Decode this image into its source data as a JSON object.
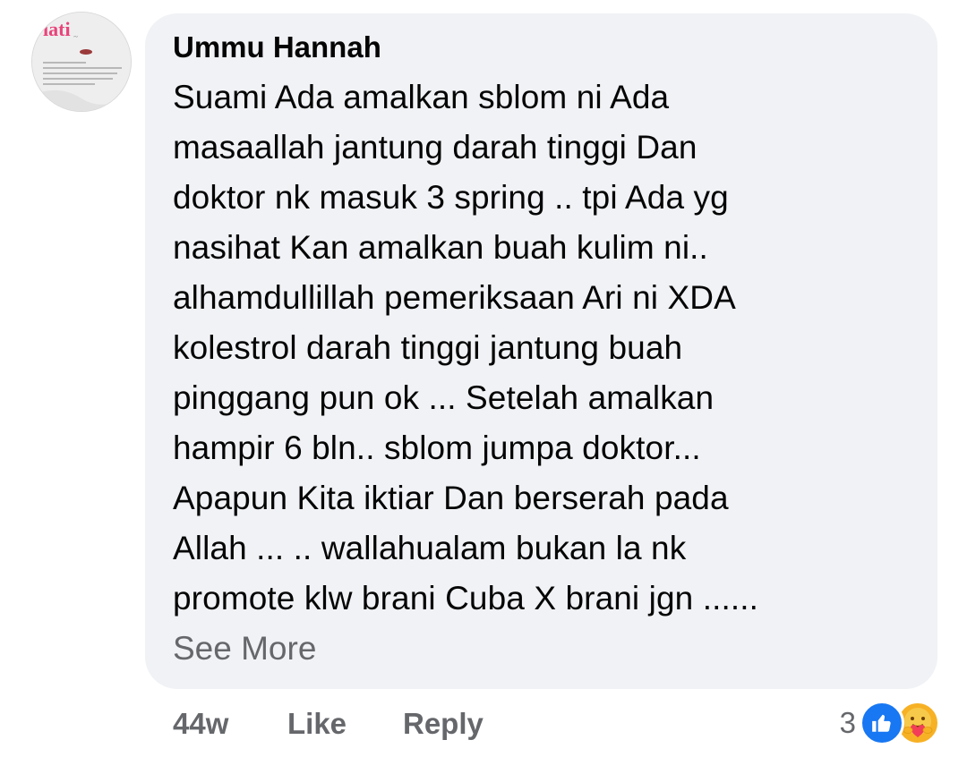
{
  "comment": {
    "author": "Ummu Hannah",
    "lines": [
      "Suami Ada amalkan sblom ni Ada",
      "masaallah jantung darah tinggi Dan",
      "doktor nk masuk 3 spring .. tpi Ada yg",
      "nasihat Kan amalkan buah kulim ni..",
      "alhamdullillah pemeriksaan Ari ni XDA",
      "kolestrol darah tinggi jantung buah",
      "pinggang pun ok ... Setelah amalkan",
      "hampir 6 bln.. sblom jumpa doktor...",
      "Apapun Kita iktiar Dan berserah pada",
      "Allah ... .. wallahualam bukan la nk",
      "promote klw brani Cuba X brani jgn ......"
    ],
    "see_more": "See More"
  },
  "avatar": {
    "brand_text": "iati"
  },
  "actions": {
    "time": "44w",
    "like": "Like",
    "reply": "Reply"
  },
  "reactions": {
    "count": "3",
    "icons": [
      "like-icon",
      "care-icon"
    ]
  },
  "colors": {
    "bubble": "#f0f2f5",
    "text": "#050505",
    "secondary": "#65676b",
    "like_blue": "#1877f2",
    "care_yellow": "#f7b125"
  }
}
